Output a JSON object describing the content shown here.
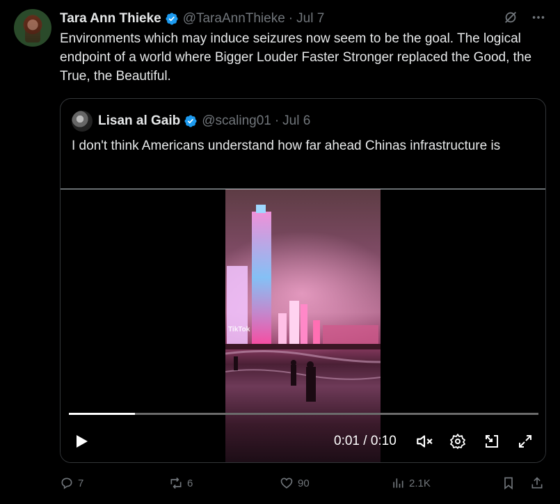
{
  "author": {
    "name": "Tara Ann Thieke",
    "handle": "@TaraAnnThieke",
    "separator": "·",
    "date": "Jul 7"
  },
  "tweet_text": "Environments which may induce seizures now seem to be the goal. The logical endpoint of a world where Bigger Louder Faster Stronger replaced the Good, the True, the Beautiful.",
  "quoted": {
    "name": "Lisan al Gaib",
    "handle": "@scaling01",
    "separator": "·",
    "date": "Jul 6",
    "text": "I don't think Americans understand how far ahead Chinas infrastructure is",
    "video": {
      "watermark": "TikTok",
      "time_display": "0:01 / 0:10",
      "progress_fraction": 0.14
    }
  },
  "actions": {
    "replies": "7",
    "reposts": "6",
    "likes": "90",
    "views": "2.1K"
  },
  "colors": {
    "background": "#000000",
    "text": "#e7e9ea",
    "muted": "#71767b",
    "verified": "#1d9bf0",
    "border": "#333639"
  }
}
